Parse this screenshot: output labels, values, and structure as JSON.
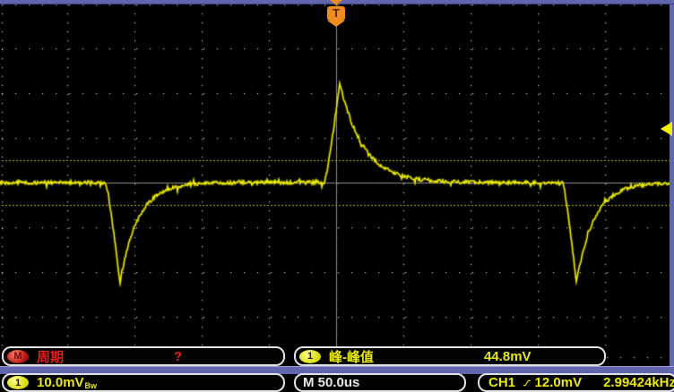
{
  "colors": {
    "background": "#000000",
    "trace": "#f0f000",
    "grid_dot": "#cdcdcd",
    "center_line": "#8c8c8c",
    "half_div_dotted": "#b4b400",
    "blue_bar": "#6067af",
    "box_border": "#e2e2e2",
    "red": "#e02020",
    "yellow": "#e8e810",
    "orange": "#f08c1e"
  },
  "trigger_position_marker": {
    "symbol": "T"
  },
  "measurements": [
    {
      "badge": "M",
      "label": "周期",
      "value": "?"
    },
    {
      "badge": "1",
      "label": "峰-峰值",
      "value": "44.8mV"
    }
  ],
  "status_bar": {
    "channel_badge": "1",
    "vertical_scale": "10.0mV",
    "bandwidth_limit": "Bw",
    "timebase": "M 50.0us",
    "trigger_source": "CH1",
    "trigger_level": "12.0mV",
    "trigger_frequency": "2.99424kHz"
  },
  "chart_data": {
    "type": "line",
    "title": "",
    "series": [
      {
        "name": "CH1",
        "color": "#f0f000"
      }
    ],
    "x_axis": {
      "units": "us",
      "time_per_div": 50.0,
      "divisions": 10,
      "range": [
        -250,
        250
      ]
    },
    "y_axis": {
      "units": "mV",
      "volts_per_div": 10.0,
      "divisions": 8,
      "range": [
        -40,
        40
      ]
    },
    "baseline_mV": 0,
    "noise_mVpp": 1.0,
    "peak_to_peak_mV": 44.8,
    "trigger_level_mV": 12.0,
    "trigger_position_us": 0,
    "signal_frequency_hz": 2994.24,
    "half_div_reference_lines_mV": [
      5,
      -5
    ],
    "pulses": [
      {
        "t_us": -160.7,
        "amplitude_mV": -22.4,
        "rise_us": 10.7,
        "decay_tau_us": 13.3
      },
      {
        "t_us": 2.7,
        "amplitude_mV": 22.4,
        "rise_us": 11.3,
        "decay_tau_us": 17.3
      },
      {
        "t_us": 178.7,
        "amplitude_mV": -22.4,
        "rise_us": 10.0,
        "decay_tau_us": 13.3
      }
    ],
    "legend": false,
    "grid": "dotted"
  }
}
